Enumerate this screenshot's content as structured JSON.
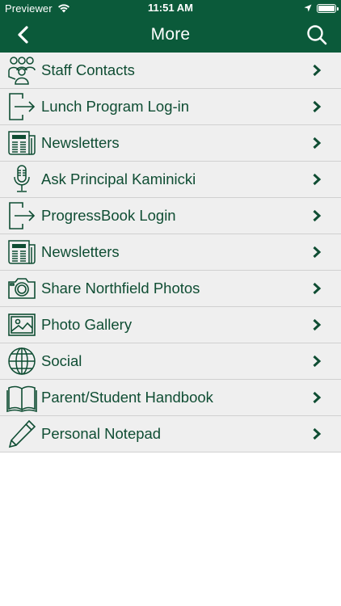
{
  "status_bar": {
    "carrier": "Previewer",
    "time": "11:51 AM"
  },
  "nav": {
    "title": "More"
  },
  "colors": {
    "header_bg": "#0b5a3a",
    "text": "#0f4d33",
    "row_bg": "#efefef"
  },
  "items": [
    {
      "label": "Staff Contacts",
      "icon": "people-icon"
    },
    {
      "label": "Lunch Program Log-in",
      "icon": "login-icon"
    },
    {
      "label": "Newsletters",
      "icon": "newspaper-icon"
    },
    {
      "label": "Ask Principal Kaminicki",
      "icon": "microphone-icon"
    },
    {
      "label": "ProgressBook Login",
      "icon": "login-icon"
    },
    {
      "label": "Newsletters",
      "icon": "newspaper-icon"
    },
    {
      "label": "Share Northfield Photos",
      "icon": "camera-icon"
    },
    {
      "label": "Photo Gallery",
      "icon": "picture-icon"
    },
    {
      "label": "Social",
      "icon": "globe-icon"
    },
    {
      "label": "Parent/Student Handbook",
      "icon": "book-icon"
    },
    {
      "label": "Personal Notepad",
      "icon": "pencil-icon"
    }
  ]
}
